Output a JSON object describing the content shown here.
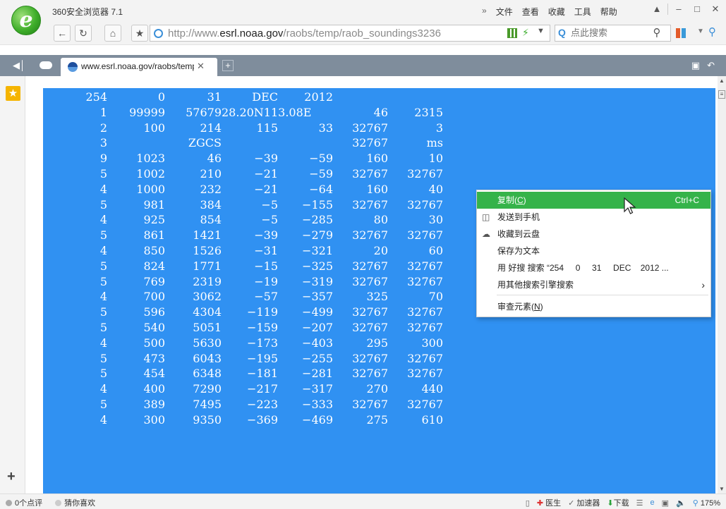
{
  "window": {
    "app_title": "360安全浏览器 7.1",
    "menu": [
      "文件",
      "查看",
      "收藏",
      "工具",
      "帮助"
    ],
    "menu_more": "»"
  },
  "toolbar": {
    "url_prefix": "http://www.",
    "url_domain": "esrl.noaa.gov",
    "url_suffix": "/raobs/temp/raob_soundings3236",
    "search_placeholder": "点此搜索"
  },
  "tabs": [
    {
      "title": "www.esrl.noaa.gov/raobs/temp"
    }
  ],
  "content": {
    "rows": [
      [
        "254",
        "0",
        "31",
        "DEC",
        "2012",
        "",
        "",
        ""
      ],
      [
        "1",
        "99999",
        "57679",
        "28.20N113.08E",
        "",
        "46",
        "2315",
        ""
      ],
      [
        "2",
        "100",
        "214",
        "115",
        "33",
        "32767",
        "3",
        ""
      ],
      [
        "3",
        "",
        "ZGCS",
        "",
        "",
        "32767",
        "ms",
        ""
      ],
      [
        "9",
        "1023",
        "46",
        "−39",
        "−59",
        "160",
        "10",
        ""
      ],
      [
        "5",
        "1002",
        "210",
        "−21",
        "−59",
        "32767",
        "32767",
        ""
      ],
      [
        "4",
        "1000",
        "232",
        "−21",
        "−64",
        "160",
        "40",
        ""
      ],
      [
        "5",
        "981",
        "384",
        "−5",
        "−155",
        "32767",
        "32767",
        ""
      ],
      [
        "4",
        "925",
        "854",
        "−5",
        "−285",
        "80",
        "30",
        ""
      ],
      [
        "5",
        "861",
        "1421",
        "−39",
        "−279",
        "32767",
        "32767",
        ""
      ],
      [
        "4",
        "850",
        "1526",
        "−31",
        "−321",
        "20",
        "60",
        ""
      ],
      [
        "5",
        "824",
        "1771",
        "−15",
        "−325",
        "32767",
        "32767",
        ""
      ],
      [
        "5",
        "769",
        "2319",
        "−19",
        "−319",
        "32767",
        "32767",
        ""
      ],
      [
        "4",
        "700",
        "3062",
        "−57",
        "−357",
        "325",
        "70",
        ""
      ],
      [
        "5",
        "596",
        "4304",
        "−119",
        "−499",
        "32767",
        "32767",
        ""
      ],
      [
        "5",
        "540",
        "5051",
        "−159",
        "−207",
        "32767",
        "32767",
        ""
      ],
      [
        "4",
        "500",
        "5630",
        "−173",
        "−403",
        "295",
        "300",
        ""
      ],
      [
        "5",
        "473",
        "6043",
        "−195",
        "−255",
        "32767",
        "32767",
        ""
      ],
      [
        "5",
        "454",
        "6348",
        "−181",
        "−281",
        "32767",
        "32767",
        ""
      ],
      [
        "4",
        "400",
        "7290",
        "−217",
        "−317",
        "270",
        "440",
        ""
      ],
      [
        "5",
        "389",
        "7495",
        "−223",
        "−333",
        "32767",
        "32767",
        ""
      ],
      [
        "4",
        "300",
        "9350",
        "−369",
        "−469",
        "275",
        "610",
        ""
      ]
    ]
  },
  "context_menu": {
    "items": [
      {
        "label": "复制(",
        "mnemonic": "C",
        "label_end": ")",
        "shortcut": "Ctrl+C"
      },
      {
        "label": "发送到手机"
      },
      {
        "label": "收藏到云盘"
      },
      {
        "label": "保存为文本"
      },
      {
        "label": "用 好搜 搜索 “254     0     31     DEC    2012 ..."
      },
      {
        "label": "用其他搜索引擎搜索",
        "submenu_arrow": "›"
      },
      {
        "label": "审查元素(",
        "mnemonic": "N",
        "label_end": ")"
      }
    ]
  },
  "statusbar": {
    "reviews": "0个点评",
    "guess": "猜你喜欢",
    "doctor": "医生",
    "accelerator": "加速器",
    "download": "下载",
    "zoom": "175%"
  },
  "colors": {
    "selection": "#3091f2",
    "menu_highlight": "#35b34a",
    "tabbar": "#7f8d9c"
  }
}
